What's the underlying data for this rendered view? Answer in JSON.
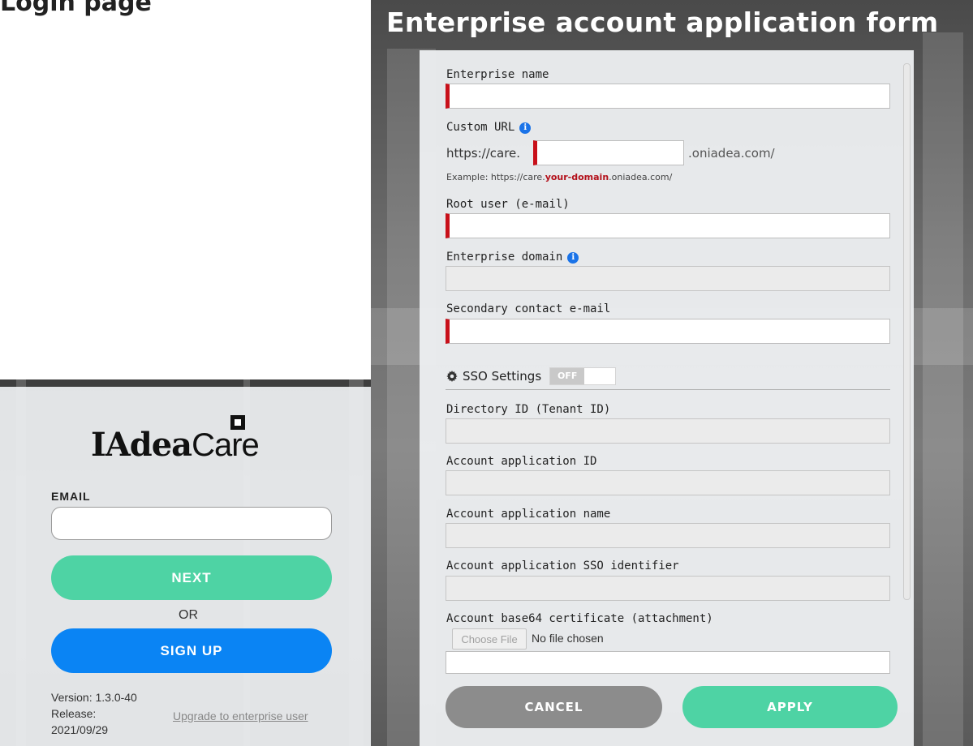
{
  "caption": {
    "text": "Login page"
  },
  "login": {
    "logo": {
      "bold": "IAdea",
      "light": "Care"
    },
    "email_label": "EMAIL",
    "email_value": "",
    "next_label": "NEXT",
    "or_label": "OR",
    "signup_label": "SIGN UP",
    "version": "Version: 1.3.0-40",
    "release_label": "Release:",
    "release_date": "2021/09/29",
    "upgrade_link": "Upgrade to enterprise user"
  },
  "form": {
    "title": "Enterprise account application form",
    "fields": {
      "enterprise_name": {
        "label": "Enterprise name",
        "value": "",
        "required": true
      },
      "custom_url": {
        "label": "Custom URL",
        "prefix": "https://care.",
        "suffix": ".oniadea.com/",
        "value": "",
        "example_prefix": "Example: https://care.",
        "example_highlight": "your-domain",
        "example_suffix": ".oniadea.com/",
        "required": true
      },
      "root_user": {
        "label": "Root user (e-mail)",
        "value": "",
        "required": true
      },
      "enterprise_domain": {
        "label": "Enterprise domain",
        "value": "",
        "required": false
      },
      "secondary_contact": {
        "label": "Secondary contact e-mail",
        "value": "",
        "required": true
      }
    },
    "sso": {
      "label": "SSO Settings",
      "toggle": "OFF",
      "fields": {
        "directory_id": {
          "label": "Directory ID (Tenant ID)",
          "value": ""
        },
        "app_id": {
          "label": "Account application ID",
          "value": ""
        },
        "app_name": {
          "label": "Account application name",
          "value": ""
        },
        "sso_identifier": {
          "label": "Account application SSO identifier",
          "value": ""
        },
        "certificate": {
          "label": "Account base64 certificate (attachment)",
          "choose_file": "Choose File",
          "no_file": "No file chosen"
        }
      }
    },
    "cancel_label": "CANCEL",
    "apply_label": "APPLY"
  },
  "colors": {
    "accent_green": "#4ed3a4",
    "accent_blue": "#0a84f4",
    "required_red": "#c8101a",
    "info_blue": "#1a73e8",
    "cancel_gray": "#8c8c8c"
  },
  "icons": [
    "info-icon",
    "gear-icon",
    "logo-mark-icon"
  ]
}
